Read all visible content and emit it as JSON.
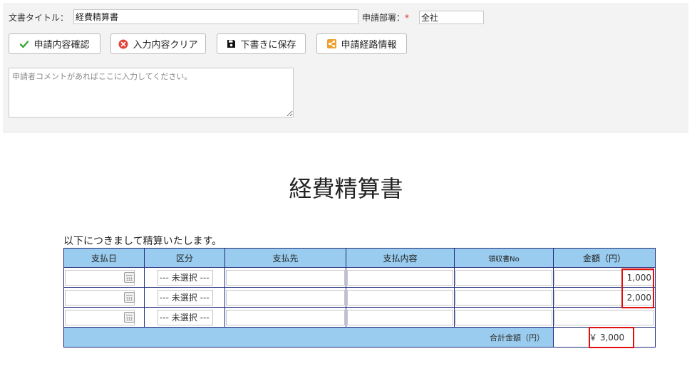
{
  "form": {
    "title_label": "文書タイトル：",
    "title_value": "経費精算書",
    "dept_label": "申請部署：",
    "required_mark": "*",
    "dept_value": "全社",
    "comment_placeholder": "申請者コメントがあればここに入力してください。"
  },
  "toolbar": {
    "confirm_label": "申請内容確認",
    "clear_label": "入力内容クリア",
    "save_label": "下書きに保存",
    "route_label": "申請経路情報"
  },
  "doc": {
    "heading": "経費精算書",
    "intro": "以下につきまして精算いたします。"
  },
  "table": {
    "headers": [
      "支払日",
      "区分",
      "支払先",
      "支払内容",
      "領収書No",
      "金額（円）"
    ],
    "select_placeholder": "--- 未選択 ---",
    "amounts": [
      "1,000",
      "2,000",
      ""
    ],
    "total_label": "合計金額（円）",
    "total_value": "￥ 3,000"
  },
  "colors": {
    "header_bg": "#99ccee",
    "border": "#1f2a7a",
    "highlight": "#e01010",
    "check": "#3aa832",
    "clear": "#e0453a",
    "route": "#f0a030"
  },
  "icons": [
    "check-icon",
    "clear-circle-icon",
    "save-disk-icon",
    "share-icon",
    "calendar-icon"
  ]
}
